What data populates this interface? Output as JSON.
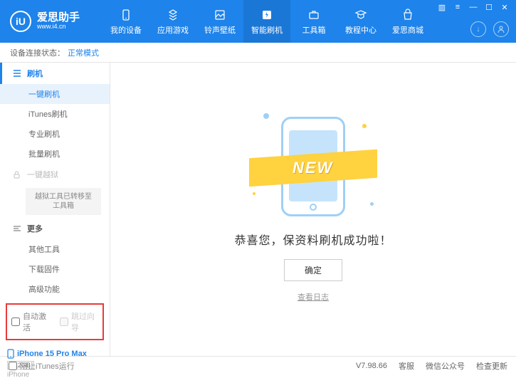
{
  "app": {
    "title": "爱思助手",
    "url": "www.i4.cn",
    "logo_letter": "iU"
  },
  "nav": [
    {
      "label": "我的设备"
    },
    {
      "label": "应用游戏"
    },
    {
      "label": "铃声壁纸"
    },
    {
      "label": "智能刷机"
    },
    {
      "label": "工具箱"
    },
    {
      "label": "教程中心"
    },
    {
      "label": "爱思商城"
    }
  ],
  "status": {
    "label": "设备连接状态：",
    "value": "正常模式"
  },
  "sidebar": {
    "flash": {
      "title": "刷机",
      "items": [
        "一键刷机",
        "iTunes刷机",
        "专业刷机",
        "批量刷机"
      ]
    },
    "jailbreak": {
      "title": "一键越狱",
      "note": "越狱工具已转移至\n工具箱"
    },
    "more": {
      "title": "更多",
      "items": [
        "其他工具",
        "下载固件",
        "高级功能"
      ]
    },
    "options": {
      "auto_activate": "自动激活",
      "skip_setup": "跳过向导"
    },
    "device": {
      "name": "iPhone 15 Pro Max",
      "storage": "512GB",
      "model": "iPhone"
    }
  },
  "main": {
    "ribbon": "NEW",
    "message": "恭喜您，保资料刷机成功啦！",
    "ok": "确定",
    "log_link": "查看日志"
  },
  "footer": {
    "block_itunes": "阻止iTunes运行",
    "version": "V7.98.66",
    "links": [
      "客服",
      "微信公众号",
      "检查更新"
    ]
  }
}
